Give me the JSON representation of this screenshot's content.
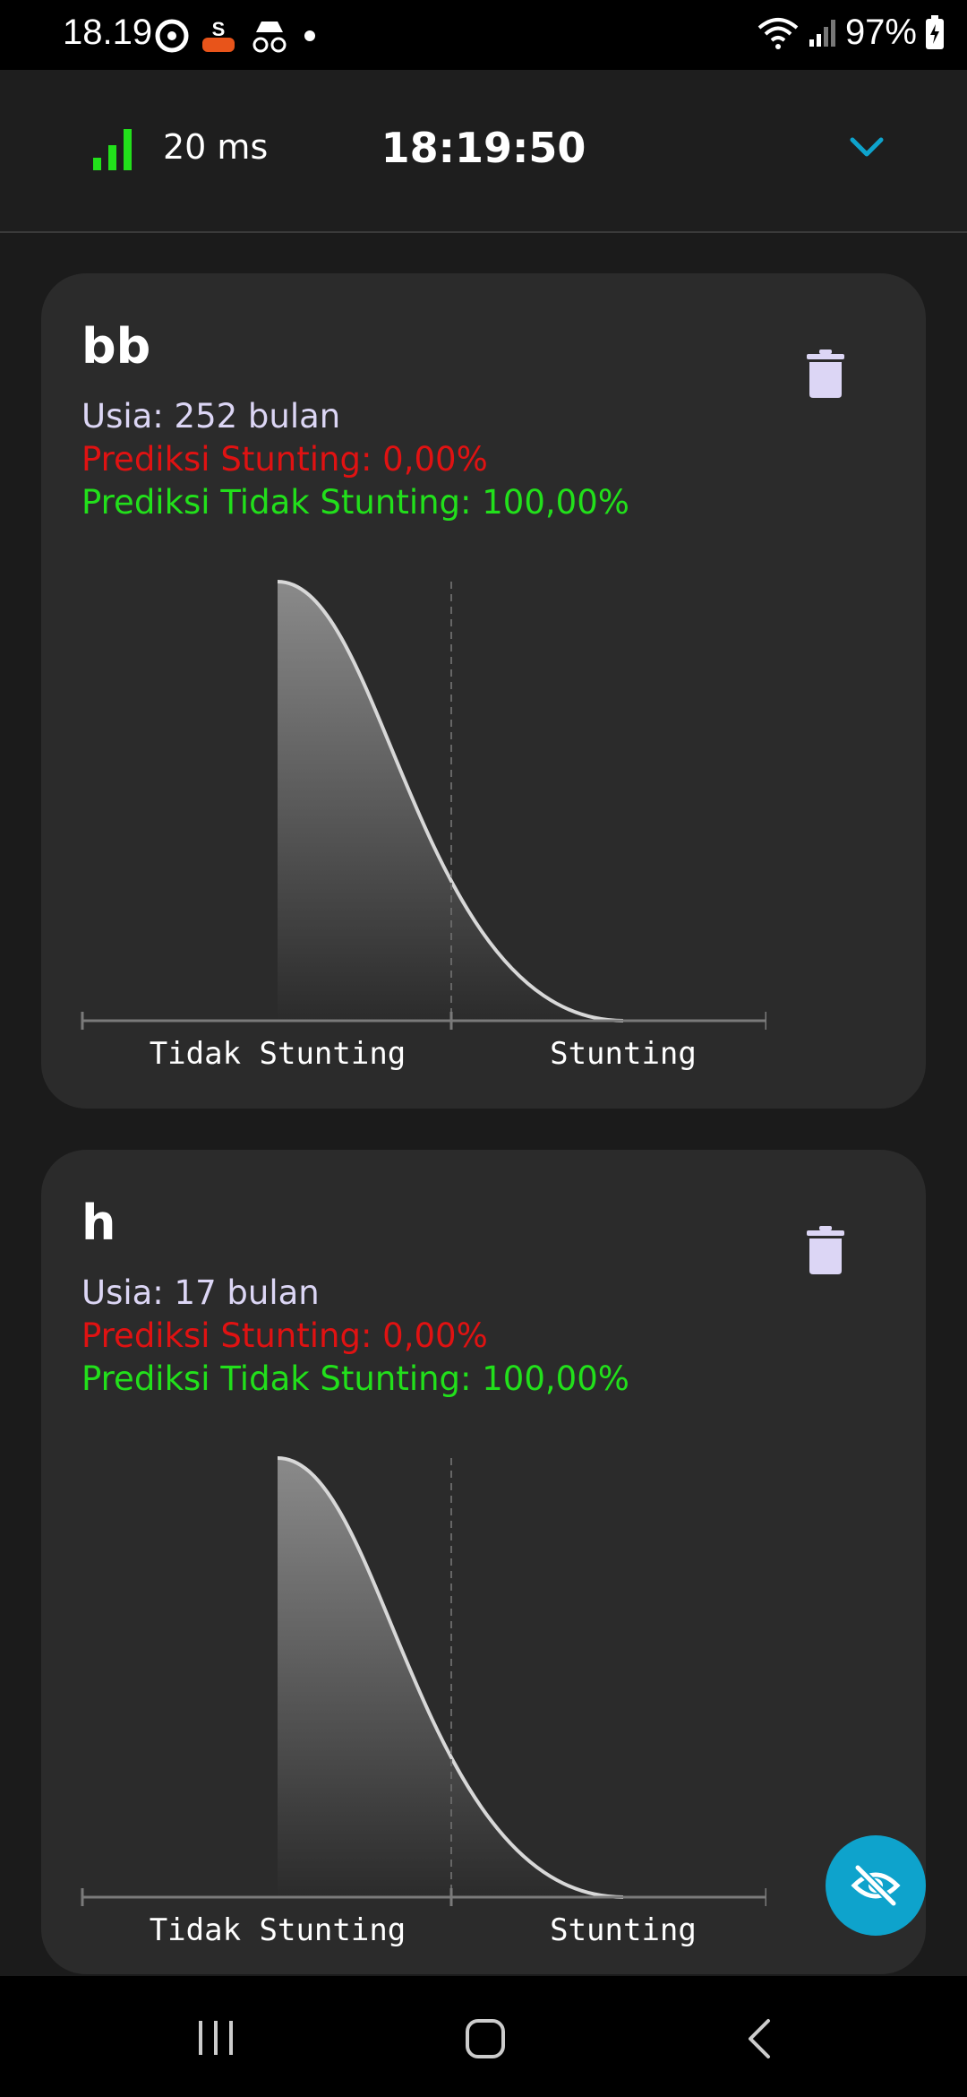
{
  "status": {
    "time": "18.19",
    "battery": "97%"
  },
  "header": {
    "ping": "20 ms",
    "clock": "18:19:50"
  },
  "cards": [
    {
      "name": "bb",
      "age": "Usia: 252 bulan",
      "pred_stunting": "Prediksi Stunting: 0,00%",
      "pred_not_stunting": "Prediksi Tidak Stunting: 100,00%",
      "chart_data": {
        "type": "area",
        "categories": [
          "Tidak Stunting",
          "Stunting"
        ],
        "values": [
          1.0,
          0.0
        ]
      }
    },
    {
      "name": "h",
      "age": "Usia: 17 bulan",
      "pred_stunting": "Prediksi Stunting: 0,00%",
      "pred_not_stunting": "Prediksi Tidak Stunting: 100,00%",
      "chart_data": {
        "type": "area",
        "categories": [
          "Tidak Stunting",
          "Stunting"
        ],
        "values": [
          1.0,
          0.0
        ]
      }
    }
  ],
  "colors": {
    "stunting": "#e01212",
    "not_stunting": "#22e01b",
    "accent": "#0ea3cc",
    "age_text": "#dcd6f5"
  },
  "icons": {
    "signal": "signal-bars-icon",
    "dropdown": "chevron-down-icon",
    "delete": "trash-icon",
    "fab": "eye-off-icon"
  }
}
